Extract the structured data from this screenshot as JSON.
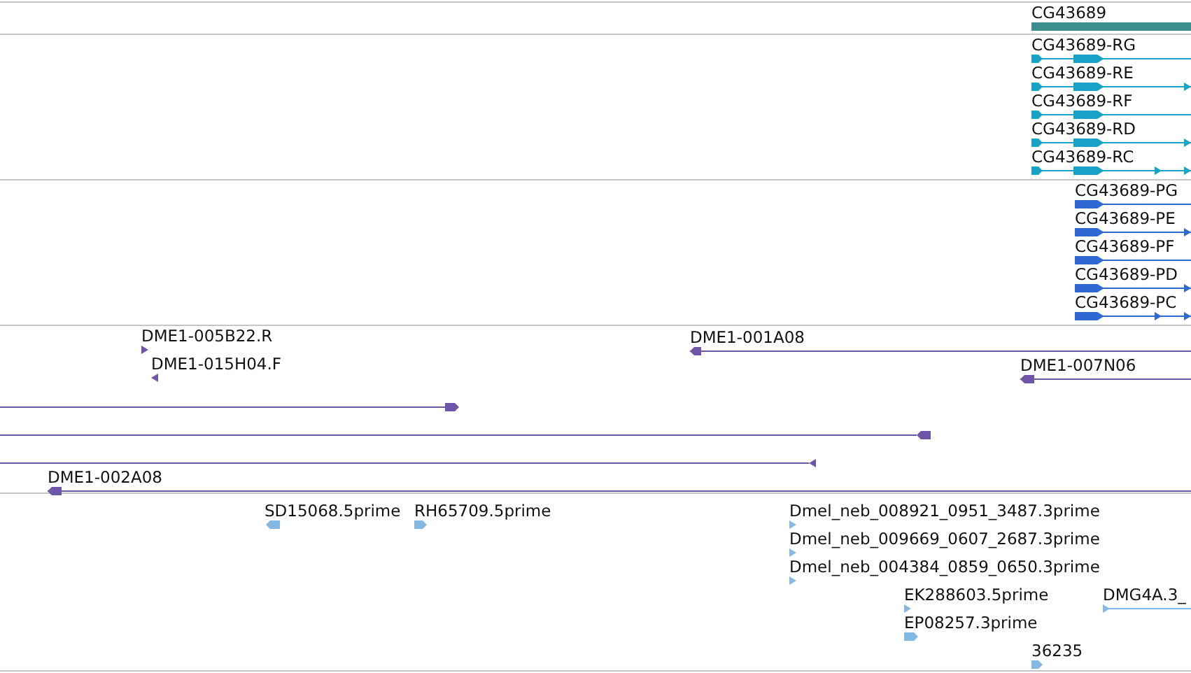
{
  "tracks": [
    {
      "kind": "gene",
      "features": [
        {
          "label": "CG43689"
        }
      ]
    },
    {
      "kind": "transcript",
      "features": [
        {
          "label": "CG43689-RG",
          "reverse": false
        },
        {
          "label": "CG43689-RE",
          "reverse": false
        },
        {
          "label": "CG43689-RF",
          "reverse": false
        },
        {
          "label": "CG43689-RD",
          "reverse": false
        },
        {
          "label": "CG43689-RC",
          "reverse": false
        }
      ]
    },
    {
      "kind": "protein",
      "features": [
        {
          "label": "CG43689-PG",
          "reverse": false
        },
        {
          "label": "CG43689-PE",
          "reverse": false
        },
        {
          "label": "CG43689-PF",
          "reverse": false
        },
        {
          "label": "CG43689-PD",
          "reverse": false
        },
        {
          "label": "CG43689-PC",
          "reverse": false
        }
      ]
    },
    {
      "kind": "clone",
      "features": [
        {
          "label": "DME1-005B22.R",
          "reverse": false
        },
        {
          "label": "DME1-015H04.F",
          "reverse": true
        },
        {
          "label": "DME1-001A08",
          "reverse": true
        },
        {
          "label": "DME1-007N06",
          "reverse": true
        },
        {
          "reverse": false
        },
        {
          "reverse": true
        },
        {
          "reverse": true
        },
        {
          "label": "DME1-002A08",
          "reverse": true
        }
      ]
    },
    {
      "kind": "est",
      "features": [
        {
          "label": "SD15068.5prime",
          "reverse": true
        },
        {
          "label": "RH65709.5prime",
          "reverse": false
        },
        {
          "label": "Dmel_neb_008921_0951_3487.3prime",
          "reverse": false
        },
        {
          "label": "Dmel_neb_009669_0607_2687.3prime",
          "reverse": false
        },
        {
          "label": "Dmel_neb_004384_0859_0650.3prime",
          "reverse": false
        },
        {
          "label": "EK288603.5prime",
          "reverse": false
        },
        {
          "label": "DMG4A.3_",
          "reverse": false
        },
        {
          "label": "EP08257.3prime",
          "reverse": false
        },
        {
          "label": "36235",
          "reverse": false
        }
      ]
    }
  ]
}
